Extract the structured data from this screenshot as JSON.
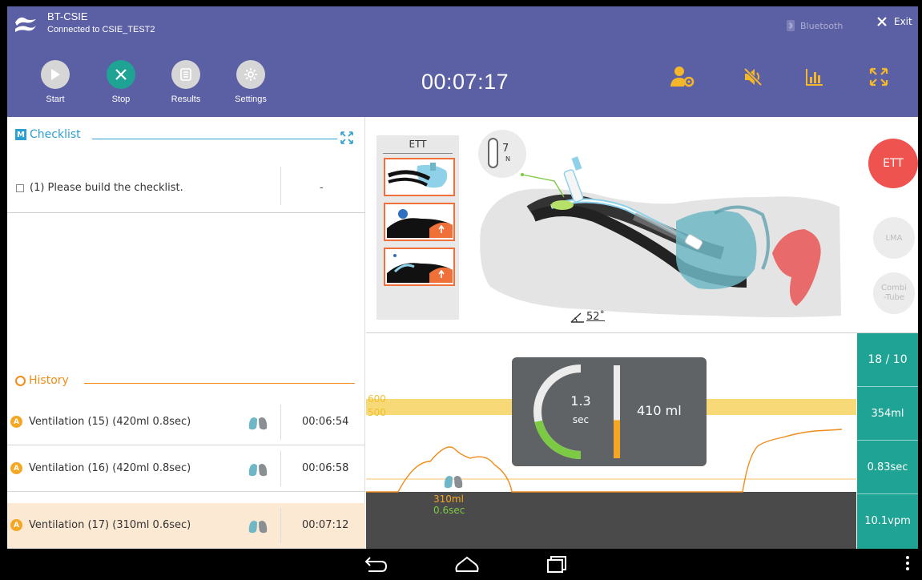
{
  "header": {
    "device_name": "BT-CSIE",
    "connection_status": "Connected to CSIE_TEST2",
    "bluetooth_label": "Bluetooth",
    "exit_label": "Exit",
    "timer": "00:07:17",
    "toolbar": [
      {
        "id": "start",
        "label": "Start",
        "icon": "play-icon",
        "color": "#d6d6d6"
      },
      {
        "id": "stop",
        "label": "Stop",
        "icon": "close-icon",
        "color": "#1ea395"
      },
      {
        "id": "results",
        "label": "Results",
        "icon": "document-icon",
        "color": "#d6d6d6"
      },
      {
        "id": "settings",
        "label": "Settings",
        "icon": "gear-icon",
        "color": "#d6d6d6"
      }
    ],
    "right_icons": [
      "user-settings-icon",
      "mute-icon",
      "chart-icon",
      "fullscreen-icon"
    ],
    "bg_color": "#5b5fa3"
  },
  "checklist": {
    "badge": "M",
    "title": "Checklist",
    "item_text": "(1) Please build the checklist.",
    "item_value": "-"
  },
  "history": {
    "title": "History",
    "rows": [
      {
        "badge": "A",
        "text": "Ventilation (15) (420ml 0.8sec)",
        "time": "00:06:54"
      },
      {
        "badge": "A",
        "text": "Ventilation (16) (420ml 0.8sec)",
        "time": "00:06:58"
      },
      {
        "badge": "A",
        "text": "Ventilation (17) (310ml 0.6sec)",
        "time": "00:07:12"
      }
    ]
  },
  "ett": {
    "panel_label": "ETT",
    "pressure_value": "7",
    "pressure_unit": "N",
    "angle": "52˚",
    "side_buttons": {
      "ett": "ETT",
      "lma": "LMA",
      "combi_line1": "Combi",
      "combi_line2": "-Tube"
    }
  },
  "graph": {
    "label_600": "600",
    "label_500": "500",
    "marker_volume": "310ml",
    "marker_time": "0.6sec",
    "popup": {
      "time_value": "1.3",
      "time_unit": "sec",
      "volume": "410 ml",
      "time_fraction": 0.43,
      "volume_fraction": 0.41
    }
  },
  "stats": {
    "ratio": "18 / 10",
    "volume": "354ml",
    "time": "0.83sec",
    "rate": "10.1vpm"
  }
}
